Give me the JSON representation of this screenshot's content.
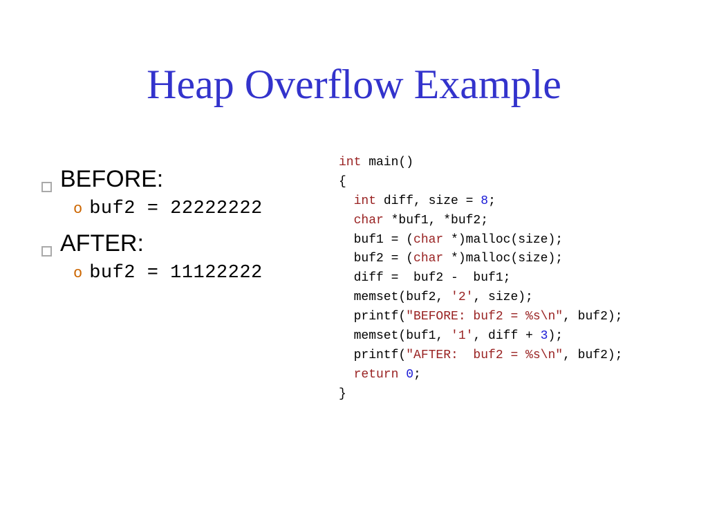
{
  "title": "Heap Overflow Example",
  "bullets": [
    {
      "label": "BEFORE:",
      "sub": "buf2 = 22222222"
    },
    {
      "label": "AFTER:",
      "sub": "buf2 = 11122222"
    }
  ],
  "code": {
    "l0a": "int",
    "l0b": " main()",
    "l1": "{",
    "l2a": "  int",
    "l2b": " diff, size = ",
    "l2c": "8",
    "l2d": ";",
    "l3a": "  char",
    "l3b": " *buf1, *buf2;",
    "l4a": "  buf1 = (",
    "l4b": "char",
    "l4c": " *)malloc(size);",
    "l5a": "  buf2 = (",
    "l5b": "char",
    "l5c": " *)malloc(size);",
    "l6": "  diff =  buf2 -  buf1;",
    "l7a": "  memset(buf2, ",
    "l7b": "'2'",
    "l7c": ", size);",
    "l8a": "  printf(",
    "l8b": "\"BEFORE: buf2 = %s\\n\"",
    "l8c": ", buf2);",
    "l9a": "  memset(buf1, ",
    "l9b": "'1'",
    "l9c": ", diff + ",
    "l9d": "3",
    "l9e": ");",
    "l10a": "  printf(",
    "l10b": "\"AFTER:  buf2 = %s\\n\"",
    "l10c": ", buf2);",
    "l11a": "  return ",
    "l11b": "0",
    "l11c": ";",
    "l12": "}"
  }
}
